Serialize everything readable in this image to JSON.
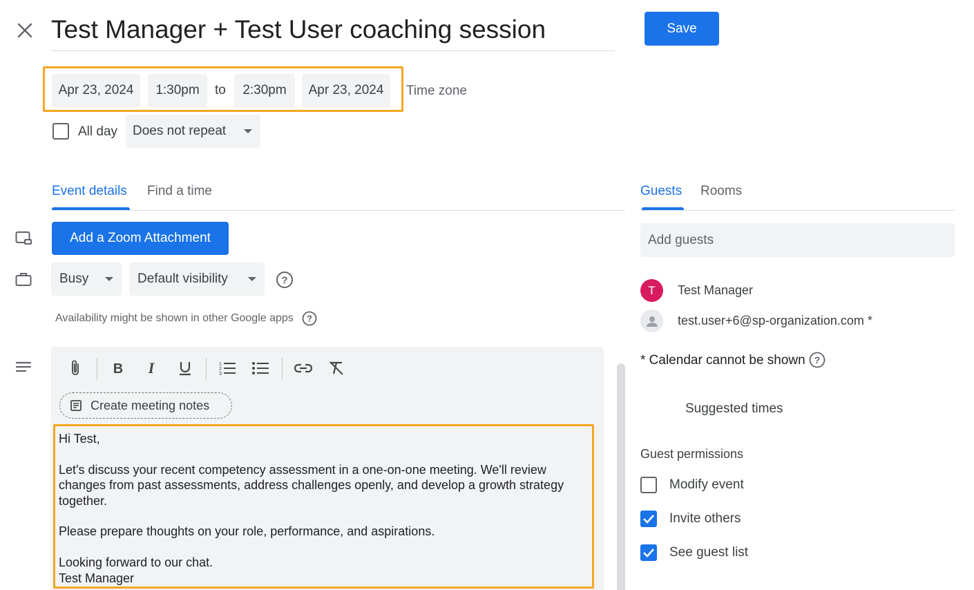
{
  "header": {
    "title": "Test Manager + Test User coaching session",
    "save_label": "Save"
  },
  "datetime": {
    "start_date": "Apr 23, 2024",
    "start_time": "1:30pm",
    "to_label": "to",
    "end_time": "2:30pm",
    "end_date": "Apr 23, 2024",
    "timezone_label": "Time zone",
    "all_day_label": "All day",
    "all_day_checked": false,
    "repeat_value": "Does not repeat"
  },
  "tabs": {
    "left": [
      {
        "label": "Event details",
        "active": true
      },
      {
        "label": "Find a time",
        "active": false
      }
    ],
    "right": [
      {
        "label": "Guests",
        "active": true
      },
      {
        "label": "Rooms",
        "active": false
      }
    ]
  },
  "details": {
    "zoom_button_label": "Add a Zoom Attachment",
    "status_value": "Busy",
    "visibility_value": "Default visibility",
    "availability_note": "Availability might be shown in other Google apps"
  },
  "editor": {
    "toolbar": [
      "attachment-icon",
      "bold-icon",
      "italic-icon",
      "underline-icon",
      "numbered-list-icon",
      "bulleted-list-icon",
      "link-icon",
      "clear-formatting-icon"
    ],
    "create_notes_label": "Create meeting notes",
    "body": {
      "greeting": "Hi Test,",
      "para1": "Let's discuss your recent competency assessment in a one-on-one meeting. We'll review\nchanges from past assessments, address challenges openly, and develop a growth strategy\ntogether.",
      "para2": "Please prepare thoughts on your role, performance, and aspirations.",
      "closing": "Looking forward to our chat.",
      "signature": "Test Manager"
    }
  },
  "guests": {
    "placeholder": "Add guests",
    "list": [
      {
        "initial": "T",
        "name": "Test Manager",
        "avatar_color": "#d81b60"
      },
      {
        "initial": "",
        "name": "test.user+6@sp-organization.com *",
        "avatar_color": "#e8eaed"
      }
    ],
    "calendar_note": "* Calendar cannot be shown",
    "suggested_times_label": "Suggested times",
    "permissions_title": "Guest permissions",
    "permissions": [
      {
        "label": "Modify event",
        "checked": false
      },
      {
        "label": "Invite others",
        "checked": true
      },
      {
        "label": "See guest list",
        "checked": true
      }
    ]
  },
  "colors": {
    "accent": "#1a73e8",
    "highlight": "#f5a623"
  }
}
